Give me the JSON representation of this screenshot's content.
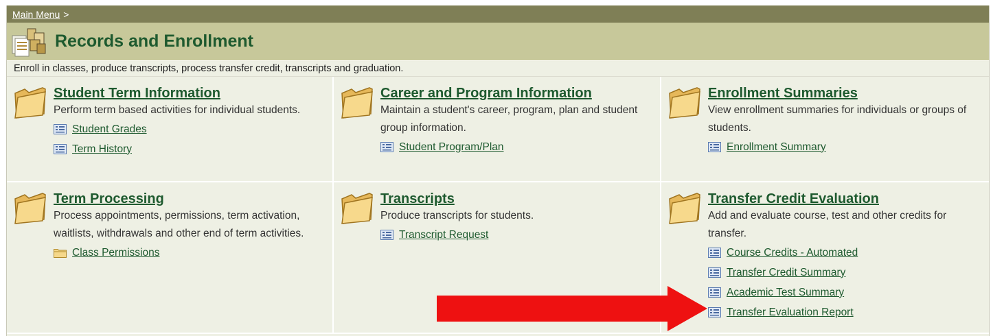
{
  "breadcrumb": {
    "link": "Main Menu",
    "separator": ">"
  },
  "page": {
    "title": "Records and Enrollment",
    "description": "Enroll in classes, produce transcripts, process transfer credit, transcripts and graduation."
  },
  "categories": [
    {
      "title": "Student Term Information",
      "description": "Perform term based activities for individual students.",
      "links": [
        {
          "label": "Student Grades",
          "icon": "document-icon"
        },
        {
          "label": "Term History",
          "icon": "document-icon"
        }
      ]
    },
    {
      "title": "Career and Program Information",
      "description": "Maintain a student's career, program, plan and student group information.",
      "links": [
        {
          "label": "Student Program/Plan",
          "icon": "document-icon"
        }
      ]
    },
    {
      "title": "Enrollment Summaries",
      "description": "View enrollment summaries for individuals or groups of students.",
      "links": [
        {
          "label": "Enrollment Summary",
          "icon": "document-icon"
        }
      ]
    },
    {
      "title": "Term Processing",
      "description": "Process appointments, permissions, term activation, waitlists, withdrawals and other end of term activities.",
      "links": [
        {
          "label": "Class Permissions",
          "icon": "folder-icon"
        }
      ]
    },
    {
      "title": "Transcripts",
      "description": "Produce transcripts for students.",
      "links": [
        {
          "label": "Transcript Request",
          "icon": "document-icon"
        }
      ]
    },
    {
      "title": "Transfer Credit Evaluation",
      "description": "Add and evaluate course, test and other credits for transfer.",
      "links": [
        {
          "label": "Course Credits - Automated",
          "icon": "document-icon"
        },
        {
          "label": "Transfer Credit Summary",
          "icon": "document-icon"
        },
        {
          "label": "Academic Test Summary",
          "icon": "document-icon"
        },
        {
          "label": "Transfer Evaluation Report",
          "icon": "document-icon"
        }
      ]
    }
  ],
  "colors": {
    "header_bar": "#7f7f56",
    "title_bar": "#c7c89a",
    "link_green": "#1e5a2f",
    "annotation_arrow": "#ee1111"
  }
}
